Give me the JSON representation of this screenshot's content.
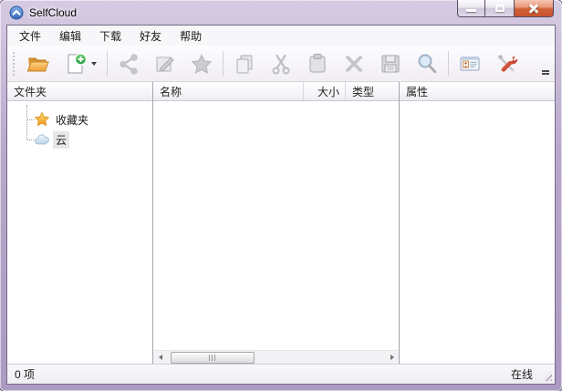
{
  "window": {
    "title": "SelfCloud",
    "app_icon": "cloud-upload-icon",
    "controls": {
      "minimize": "minimize-icon",
      "maximize": "maximize-icon",
      "close": "close-icon"
    }
  },
  "menu": {
    "items": [
      {
        "label": "文件"
      },
      {
        "label": "编辑"
      },
      {
        "label": "下载"
      },
      {
        "label": "好友"
      },
      {
        "label": "帮助"
      }
    ]
  },
  "toolbar": {
    "buttons": [
      {
        "icon": "open-folder-icon",
        "enabled": true,
        "has_dropdown": false
      },
      {
        "icon": "new-item-icon",
        "enabled": true,
        "has_dropdown": true
      },
      {
        "icon": "share-icon",
        "enabled": false
      },
      {
        "icon": "edit-icon",
        "enabled": false
      },
      {
        "icon": "favorite-star-icon",
        "enabled": false
      },
      {
        "icon": "copy-icon",
        "enabled": false
      },
      {
        "icon": "cut-icon",
        "enabled": false
      },
      {
        "icon": "paste-icon",
        "enabled": false
      },
      {
        "icon": "delete-icon",
        "enabled": false
      },
      {
        "icon": "save-icon",
        "enabled": false
      },
      {
        "icon": "search-icon",
        "enabled": false
      },
      {
        "icon": "id-card-icon",
        "enabled": true
      },
      {
        "icon": "tools-icon",
        "enabled": true
      }
    ]
  },
  "folders_panel": {
    "header": "文件夹",
    "items": [
      {
        "label": "收藏夹",
        "icon": "star-icon",
        "selected": false
      },
      {
        "label": "云",
        "icon": "cloud-icon",
        "selected": true
      }
    ]
  },
  "files_panel": {
    "columns": [
      {
        "label": "名称"
      },
      {
        "label": "大小"
      },
      {
        "label": "类型"
      }
    ],
    "rows": []
  },
  "attributes_panel": {
    "header": "属性"
  },
  "statusbar": {
    "item_count": "0 项",
    "status": "在线"
  },
  "colors": {
    "frame": "#b7a7ca",
    "close_button": "#d15f37",
    "folder_accent": "#eda23a",
    "star_accent": "#f5a623",
    "cloud_accent": "#cfe3f2",
    "new_accent": "#2fab4f"
  }
}
